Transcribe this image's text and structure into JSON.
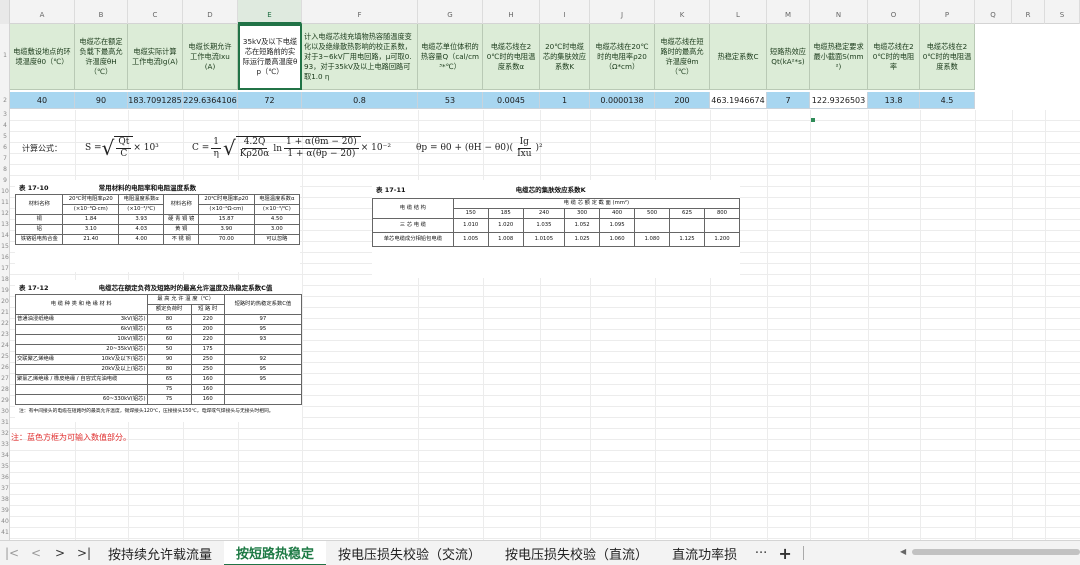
{
  "columns": [
    "A",
    "B",
    "C",
    "D",
    "E",
    "F",
    "G",
    "H",
    "I",
    "J",
    "K",
    "L",
    "M",
    "N",
    "O",
    "P",
    "Q",
    "R",
    "S"
  ],
  "rows": [
    "1",
    "2",
    "3",
    "4",
    "5",
    "6",
    "7",
    "8",
    "9",
    "10",
    "11",
    "12",
    "13",
    "14",
    "15",
    "16",
    "17",
    "18",
    "19",
    "20",
    "21",
    "22",
    "23",
    "24",
    "25",
    "26",
    "27",
    "28",
    "29",
    "30",
    "31",
    "32",
    "33",
    "34",
    "35",
    "36",
    "37",
    "38",
    "39",
    "40",
    "41"
  ],
  "headers": {
    "A": "电缆敷设地点的环境温度θ0（℃）",
    "B": "电缆芯在额定负载下最高允许温度θH（℃）",
    "C": "电缆实际计算工作电流Ig(A)",
    "D": "电缆长期允许工作电流Ixu(A)",
    "E": "35kV及以下电缆芯在短路前的实际运行最高温度θp（℃）",
    "F": "计入电缆芯线充填物热容随温度变化以及绝缘散热影响的校正系数，对于3~6kV厂用电回路，μ可取0.93，对于35kV及以上电路回路可取1.0 η",
    "G": "电缆芯单位体积的热容量Q（cal/cm³*℃）",
    "H": "电缆芯线在20℃时的电阻温度系数α",
    "I": "20℃时电缆芯的集肤效应系数K",
    "J": "电缆芯线在20℃时的电阻率ρ20（Ω*cm）",
    "K": "电缆芯线在短路时的最高允许温度θm（℃）",
    "L": "热稳定系数C",
    "M": "短路热效应Qt(kA²*s)",
    "N": "电缆热稳定要求最小截面S(mm²)",
    "O": "电缆芯线在20℃时的电阻率",
    "P": "电缆芯线在20℃时的电阻温度系数"
  },
  "values": {
    "A": "40",
    "B": "90",
    "C": "183.7091285",
    "D": "229.6364106",
    "E": "72",
    "F": "0.8",
    "G": "53",
    "H": "0.0045",
    "I": "1",
    "J": "0.0000138",
    "K": "200",
    "L": "463.1946674",
    "M": "7",
    "N": "122.9326503",
    "O": "13.8",
    "P": "4.5"
  },
  "formulas": {
    "label": "计算公式：",
    "f1_lhs": "S =",
    "f1_num": "Qt",
    "f1_den": "C",
    "f1_tail": "× 10³",
    "f2_lhs": "C =",
    "f2_coef_num": "1",
    "f2_coef_den": "η",
    "f2_rad_num": "4.2Q",
    "f2_rad_den": "Kρ20α",
    "f2_ln": "ln",
    "f2_ln_num": "1 + α(θm − 20)",
    "f2_ln_den": "1 + α(θp − 20)",
    "f2_tail": "× 10⁻²",
    "f3_lhs": "θp = θ0 + (θH − θ0)(",
    "f3_num": "Ig",
    "f3_den": "Ixu",
    "f3_tail": ")²"
  },
  "table_17_10": {
    "number": "表 17-10",
    "title": "常用材料的电阻率和电阻温度系数",
    "h1": [
      "材料名称",
      "20℃时电阻率ρ20",
      "电阻温度系数α",
      "材料名称",
      "20℃时电阻率ρ20",
      "电阻温度系数α"
    ],
    "h2": [
      "(×10⁻⁶Ω·cm)",
      "(×10⁻³/℃)",
      "(×10⁻⁶Ω·cm)",
      "(×10⁻³/℃)"
    ],
    "rows": [
      [
        "铜",
        "1.84",
        "3.93",
        "硬 青 铜 镜",
        "15.87",
        "4.50"
      ],
      [
        "铝",
        "3.10",
        "4.03",
        "黄 铜",
        "3.90",
        "3.00"
      ],
      [
        "铁铬铝电热合金",
        "21.40",
        "4.00",
        "不 锈 钢",
        "70.00",
        "可以忽略"
      ]
    ]
  },
  "table_17_12": {
    "number": "表 17-12",
    "title": "电缆芯在额定负荷及短路时的最高允许温度及热稳定系数C值",
    "h_type": "电 缆 种 类 和 绝 缘 材 料",
    "h_temp": "最 高 允 许 温 度（℃）",
    "h_normal": "额定负荷时",
    "h_short": "短 路 时",
    "h_c": "短路时的热稳定系数C值",
    "groups": [
      {
        "name": "普通油浸纸绝缘",
        "rows": [
          [
            "3kV(铝芯)",
            "80",
            "220",
            "97"
          ],
          [
            "6kV(铜芯)",
            "65",
            "200",
            "95"
          ],
          [
            "10kV(铜芯)",
            "60",
            "220",
            "93"
          ],
          [
            "20~35kV(铝芯)",
            "50",
            "175",
            ""
          ]
        ]
      },
      {
        "name": "交联聚乙烯绝缘",
        "rows": [
          [
            "10kV及以下(铝芯)",
            "90",
            "250",
            "92"
          ],
          [
            "20kV及以上(铝芯)",
            "80",
            "250",
            "95"
          ]
        ]
      },
      {
        "name": "聚氯乙烯绝缘 / 橡皮绝缘 / 自容式充油电缆",
        "rows": [
          [
            "",
            "65",
            "160",
            "95"
          ],
          [
            "",
            "75",
            "160",
            ""
          ],
          [
            "60~330kV(铝芯)",
            "75",
            "160",
            ""
          ]
        ]
      }
    ],
    "note": "注：有中间接头的电缆在短路时的最高允许温度，锡焊接头120℃，压接接头150℃，电焊或气焊接头与无接头时相同。"
  },
  "table_17_11": {
    "number": "表 17-11",
    "title": "电缆芯的集肤效应系数K",
    "h_struct": "电 缆 结 构",
    "h_section": "电 缆 芯 额 定 截 面 (mm²)",
    "sections": [
      "150",
      "185",
      "240",
      "300",
      "400",
      "500",
      "625",
      "800"
    ],
    "rows": [
      [
        "三 芯 电 缆",
        "1.010",
        "1.020",
        "1.035",
        "1.052",
        "1.095",
        "",
        "",
        ""
      ],
      [
        "单芯电缆成分相铅包电缆",
        "1.005",
        "1.008",
        "1.0105",
        "1.025",
        "1.060",
        "1.080",
        "1.125",
        "1.200"
      ]
    ]
  },
  "note": "注：蓝色方框为可输入数值部分。",
  "tabs": [
    "按持续允许载流量",
    "按短路热稳定",
    "按电压损失校验（交流）",
    "按电压损失校验（直流）",
    "直流功率损"
  ],
  "active_tab_index": 1,
  "nav": {
    "first": "|<",
    "prev": "<",
    "next": ">",
    "last": ">|",
    "more": "···",
    "add": "+"
  }
}
